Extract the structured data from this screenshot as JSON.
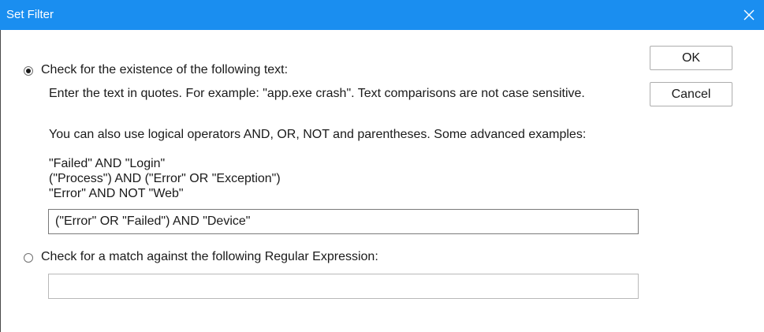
{
  "window": {
    "title": "Set Filter",
    "titlebar_color": "#1a8ef0",
    "close_glyph": "✕"
  },
  "option_text": {
    "label": "Check for the existence of the following text:",
    "help_line1": "Enter the text in quotes.  For example: \"app.exe crash\".   Text comparisons are not case sensitive.",
    "help_line2": "You can also use logical operators AND, OR, NOT and parentheses.  Some advanced examples:",
    "example1": "\"Failed\" AND \"Login\"",
    "example2": "(\"Process\") AND (\"Error\" OR \"Exception\")",
    "example3": "\"Error\" AND NOT \"Web\"",
    "value": "(\"Error\" OR \"Failed\") AND \"Device\"",
    "selected": true
  },
  "option_regex": {
    "label": "Check for a match against the following Regular Expression:",
    "value": "",
    "selected": false
  },
  "buttons": {
    "ok": "OK",
    "cancel": "Cancel"
  }
}
